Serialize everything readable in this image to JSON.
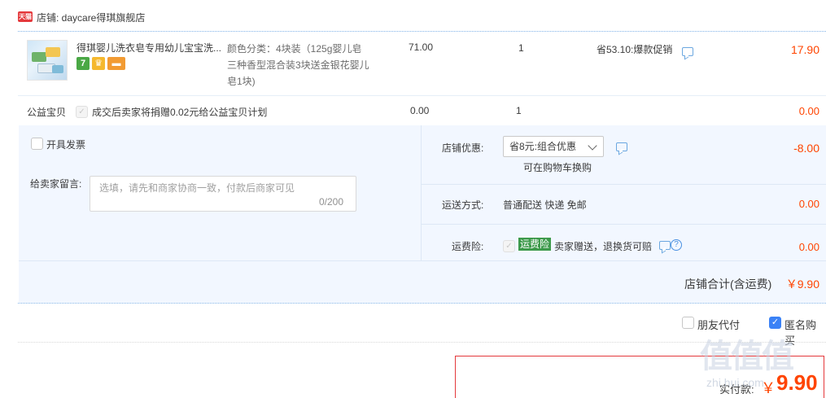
{
  "store": {
    "logo_text": "天猫",
    "name": "店铺: daycare得琪旗舰店"
  },
  "item": {
    "title": "得琪婴儿洗衣皂专用幼儿宝宝洗...",
    "badges": [
      "7",
      "",
      ""
    ],
    "sku_lines": [
      "颜色分类：4块装（125g婴儿皂",
      "三种香型混合装3块送金银花婴儿",
      "皂1块)"
    ],
    "price": "71.00",
    "qty": "1",
    "promo": "省53.10:爆款促销",
    "total": "17.90"
  },
  "charity": {
    "label": "公益宝贝",
    "text": "成交后卖家将捐赠0.02元给公益宝贝计划",
    "price": "0.00",
    "qty": "1",
    "total": "0.00"
  },
  "invoice": {
    "label": "开具发票"
  },
  "memo": {
    "label": "给卖家留言:",
    "placeholder": "选填，请先和商家协商一致，付款后商家可见",
    "count": "0/200"
  },
  "store_discount": {
    "label": "店铺优惠:",
    "selected": "省8元:组合优惠",
    "hint": "可在购物车换购",
    "value": "-8.00"
  },
  "shipping": {
    "label": "运送方式:",
    "value": "普通配送 快递 免邮",
    "total": "0.00"
  },
  "insurance": {
    "label": "运费险:",
    "tag": "运费险",
    "text": "卖家赠送，退换货可赔",
    "help": "?",
    "total": "0.00"
  },
  "summary": {
    "label": "店铺合计(含运费)",
    "value": "￥9.90"
  },
  "options": {
    "friend_pay": "朋友代付",
    "anonymous": "匿名购买"
  },
  "pay": {
    "label": "实付款:",
    "currency": "￥",
    "amount": "9.90"
  },
  "watermark": {
    "big": "值值值",
    "small": "zhi.hui.com"
  },
  "colors": {
    "accent_red": "#ff4400",
    "panel_bg": "#f2f7ff",
    "link_blue": "#3b82f6",
    "insurance_green": "#3d9a4b"
  }
}
